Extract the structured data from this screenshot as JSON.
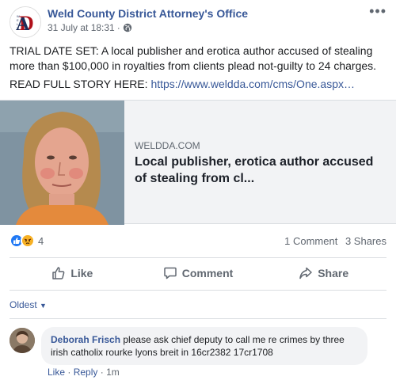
{
  "post": {
    "page_name": "Weld County District Attorney's Office",
    "date": "31 July at 18:31",
    "privacy_icon": "globe-icon",
    "more_icon": "ellipsis-icon",
    "more_label": "•••",
    "text_line1": "TRIAL DATE SET: A local publisher and erotica author accused of stealing more than $100,000 in royalties from clients plead not-guilty to 24 charges.",
    "text_line2_prefix": "READ FULL STORY HERE: ",
    "text_link": "https://www.weldda.com/cms/One.aspx…"
  },
  "link_card": {
    "domain": "WELDDA.COM",
    "title": "Local publisher, erotica author accused of stealing from cl..."
  },
  "reactions": {
    "icons": [
      "like-icon",
      "angry-icon"
    ],
    "count": "4",
    "comments": "1 Comment",
    "shares": "3 Shares"
  },
  "actions": {
    "like": "Like",
    "comment": "Comment",
    "share": "Share"
  },
  "comments": {
    "sort_label": "Oldest",
    "items": [
      {
        "author": "Deborah Frisch",
        "text": "please ask chief deputy to call me re crimes by three irish catholix rourke lyons breit in 16cr2382 17cr1708",
        "like": "Like",
        "reply": "Reply",
        "time": "1m"
      }
    ]
  },
  "colors": {
    "link": "#385898",
    "meta": "#606770",
    "like_blue": "#2078f4",
    "angry_yellow": "#f7b125"
  }
}
